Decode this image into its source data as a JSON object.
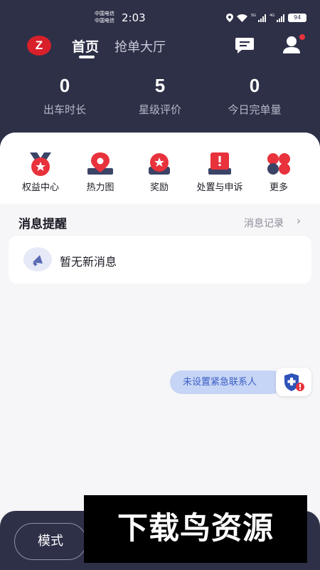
{
  "status_bar": {
    "carrier_1": "中国电信",
    "carrier_2": "中国电信",
    "time": "2:03",
    "network_tag_1": "5G",
    "network_tag_2": "4G",
    "battery": "94"
  },
  "nav": {
    "logo_letter": "Z",
    "tab_home": "首页",
    "tab_hall": "抢单大厅"
  },
  "stats": [
    {
      "value": "0",
      "label": "出车时长"
    },
    {
      "value": "5",
      "label": "星级评价"
    },
    {
      "value": "0",
      "label": "今日完单量"
    }
  ],
  "quick_menu": [
    {
      "label": "权益中心",
      "icon": "rights-badge-icon"
    },
    {
      "label": "热力图",
      "icon": "map-pin-icon"
    },
    {
      "label": "奖励",
      "icon": "reward-icon"
    },
    {
      "label": "处置与申诉",
      "icon": "appeal-icon"
    },
    {
      "label": "更多",
      "icon": "more-icon"
    }
  ],
  "messages": {
    "title": "消息提醒",
    "link": "消息记录",
    "empty_text": "暂无新消息"
  },
  "emergency": {
    "label": "未设置紧急联系人"
  },
  "bottom": {
    "mode_label": "模式"
  },
  "watermark": "下载鸟资源",
  "colors": {
    "header_bg": "#2e3048",
    "accent_red": "#d8202a",
    "pill_blue": "#c6d4f6"
  }
}
